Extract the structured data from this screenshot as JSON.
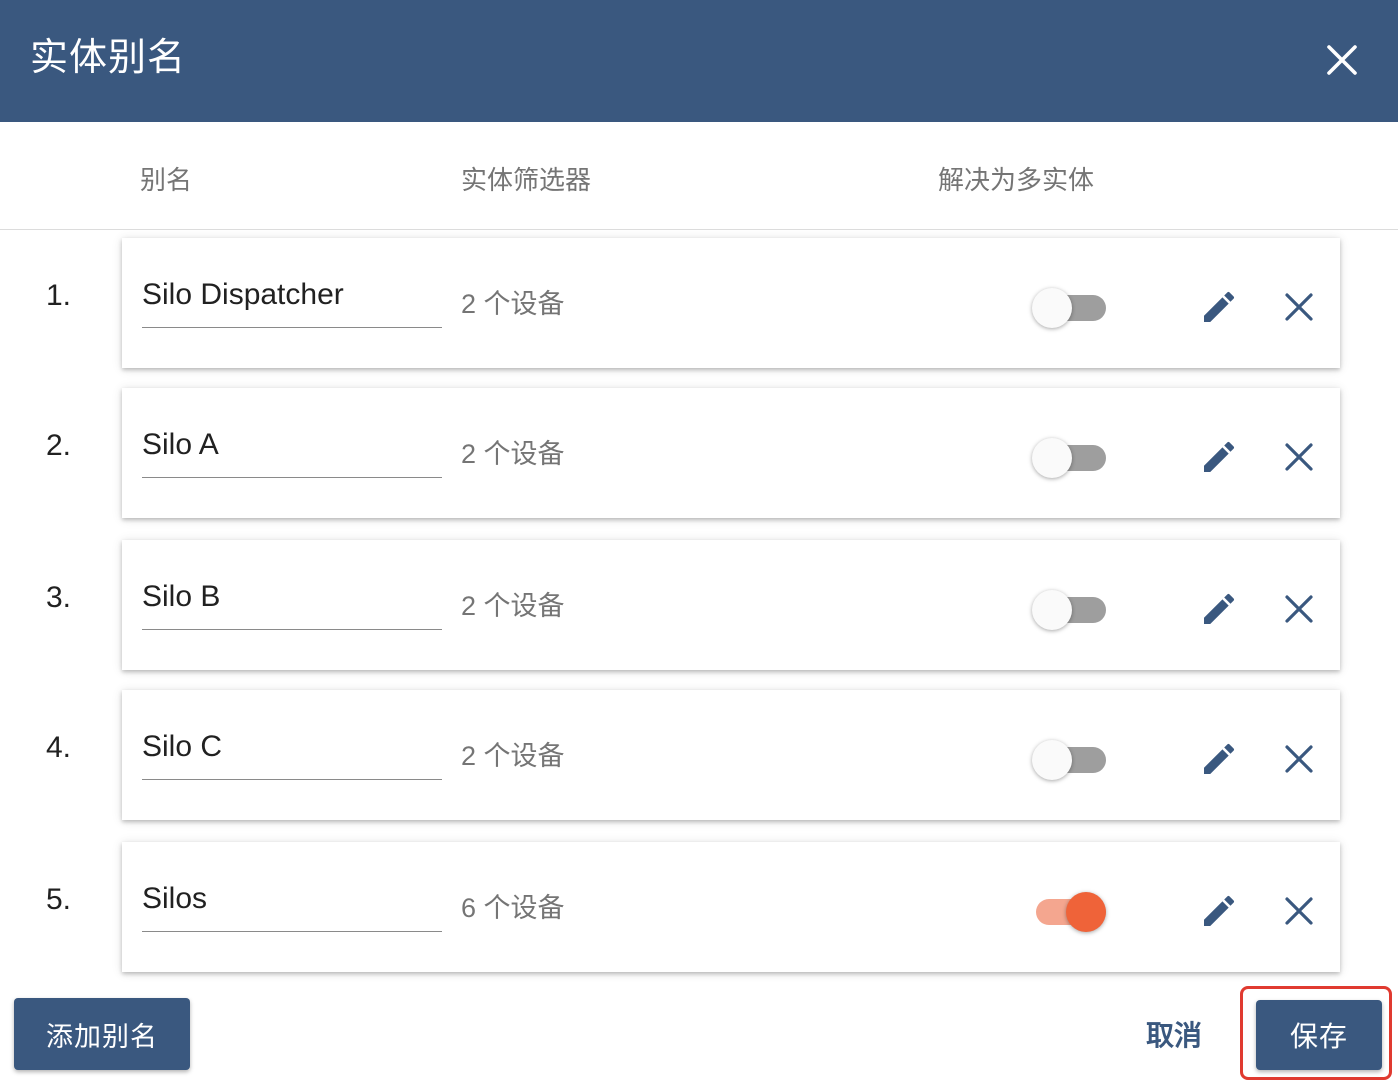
{
  "dialog": {
    "title": "实体别名",
    "close_icon": "close-icon"
  },
  "columns": {
    "alias": "别名",
    "filter": "实体筛选器",
    "resolve_multiple": "解决为多实体"
  },
  "rows": [
    {
      "index": "1.",
      "alias": "Silo Dispatcher",
      "filter": "2 个设备",
      "resolve_multiple": false
    },
    {
      "index": "2.",
      "alias": "Silo A",
      "filter": "2 个设备",
      "resolve_multiple": false
    },
    {
      "index": "3.",
      "alias": "Silo B",
      "filter": "2 个设备",
      "resolve_multiple": false
    },
    {
      "index": "4.",
      "alias": "Silo C",
      "filter": "2 个设备",
      "resolve_multiple": false
    },
    {
      "index": "5.",
      "alias": "Silos",
      "filter": "6 个设备",
      "resolve_multiple": true
    }
  ],
  "footer": {
    "add_label": "添加别名",
    "cancel_label": "取消",
    "save_label": "保存"
  },
  "colors": {
    "primary": "#3a587f",
    "toggle_on": "#ef6339",
    "highlight": "#e03a30"
  }
}
